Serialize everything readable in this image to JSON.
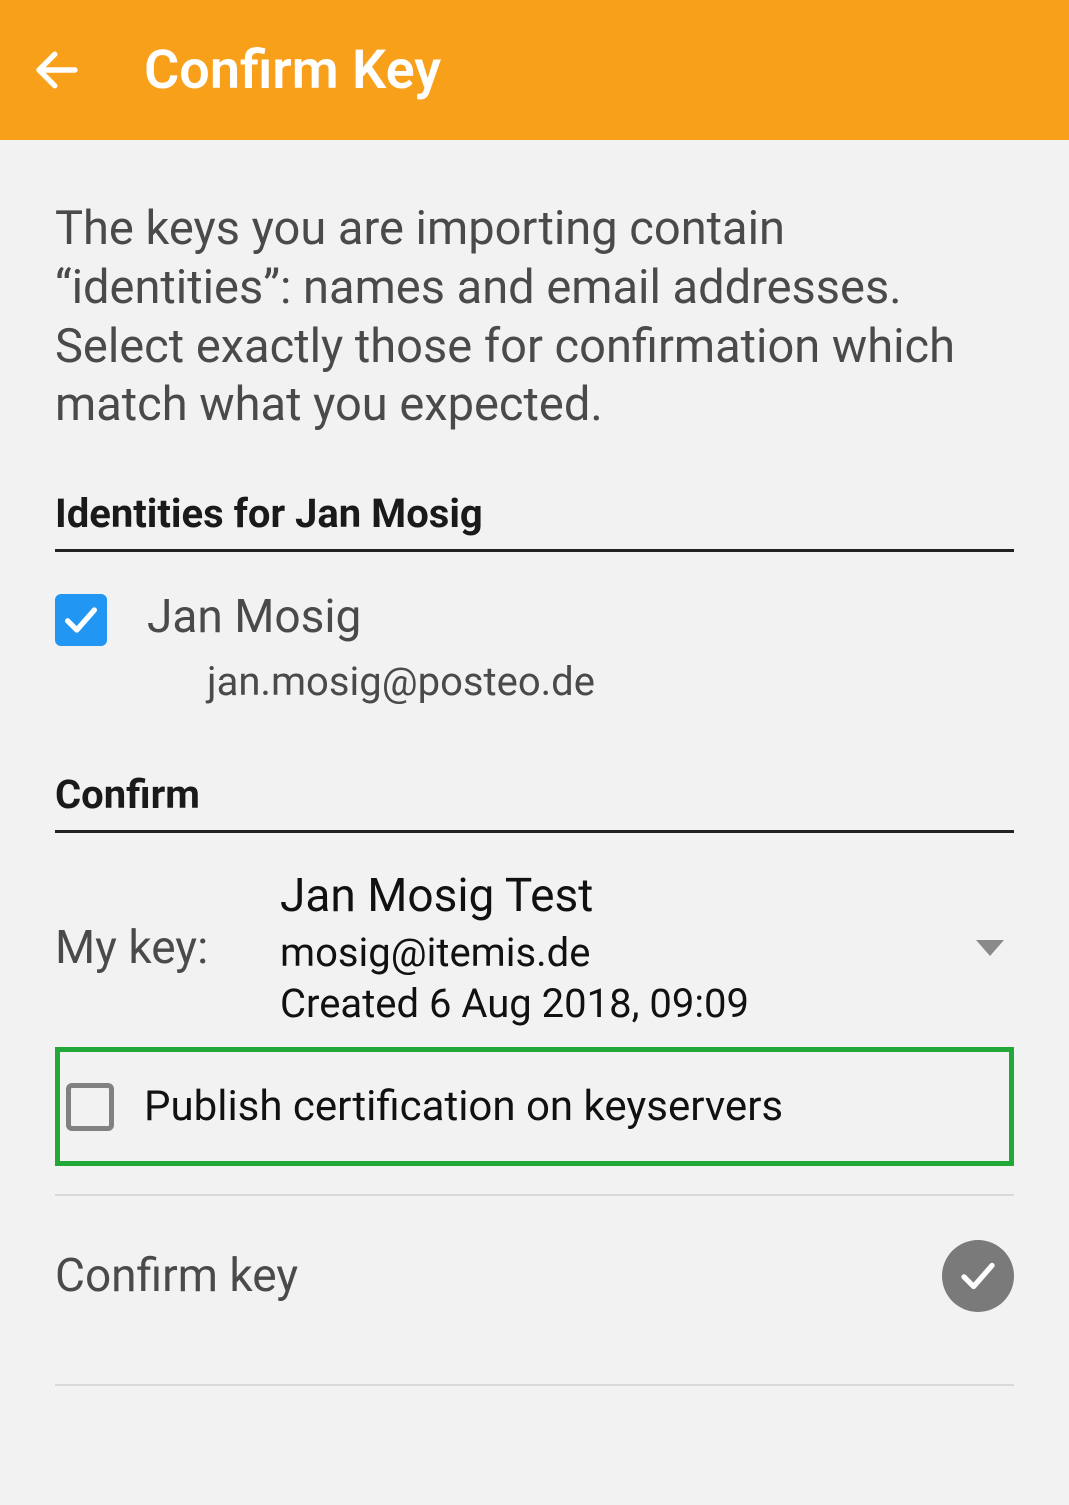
{
  "appbar": {
    "title": "Confirm Key"
  },
  "intro": "The keys you are importing contain “identities”: names and email addresses. Select exactly those for confirmation which match what you expected.",
  "identitiesHeader": "Identities for Jan Mosig",
  "identity": {
    "checked": true,
    "name": "Jan Mosig",
    "email": "jan.mosig@posteo.de"
  },
  "confirmHeader": "Confirm",
  "myKey": {
    "label": "My key:",
    "name": "Jan Mosig Test",
    "email": "mosig@itemis.de",
    "created": "Created 6 Aug 2018, 09:09"
  },
  "publish": {
    "checked": false,
    "label": "Publish certification on keyservers"
  },
  "confirmKey": {
    "label": "Confirm key"
  }
}
